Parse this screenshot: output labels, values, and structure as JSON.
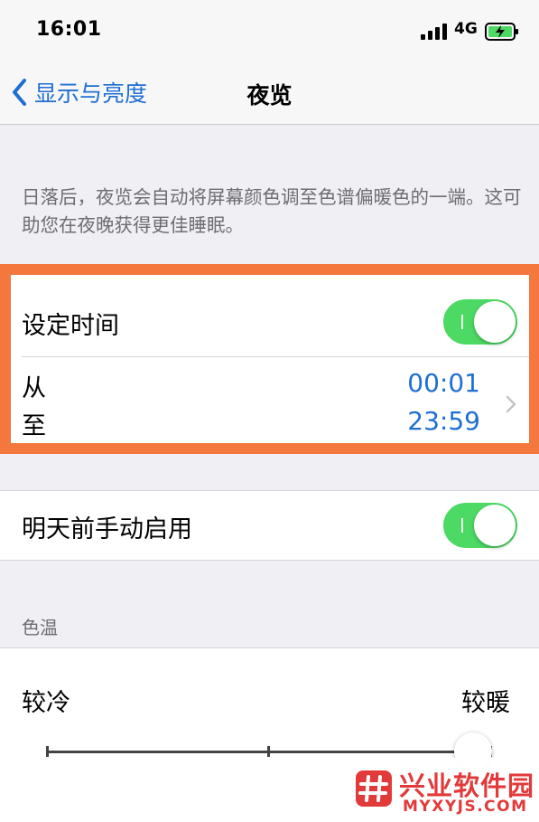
{
  "status_bar": {
    "time": "16:01",
    "network": "4G",
    "signal_icon": "cellular-signal-icon",
    "battery_icon": "battery-charging-icon"
  },
  "nav": {
    "back_label": "显示与亮度",
    "title": "夜览"
  },
  "description": "日落后，夜览会自动将屏幕颜色调至色谱偏暖色的一端。这可助您在夜晚获得更佳睡眠。",
  "scheduled": {
    "label": "设定时间",
    "enabled": true,
    "from_label": "从",
    "to_label": "至",
    "from_time": "00:01",
    "to_time": "23:59"
  },
  "manual": {
    "label": "明天前手动启用",
    "enabled": true
  },
  "color_temperature": {
    "section_label": "色温",
    "min_label": "较冷",
    "max_label": "较暖",
    "level": 1.0
  },
  "watermark": {
    "title": "兴业软件园",
    "url": "MYXYJS.COM"
  },
  "colors": {
    "accent": "#1f6fd3",
    "toggle_on": "#4cd964",
    "highlight_border": "#f4783e",
    "background": "#efeff4"
  }
}
